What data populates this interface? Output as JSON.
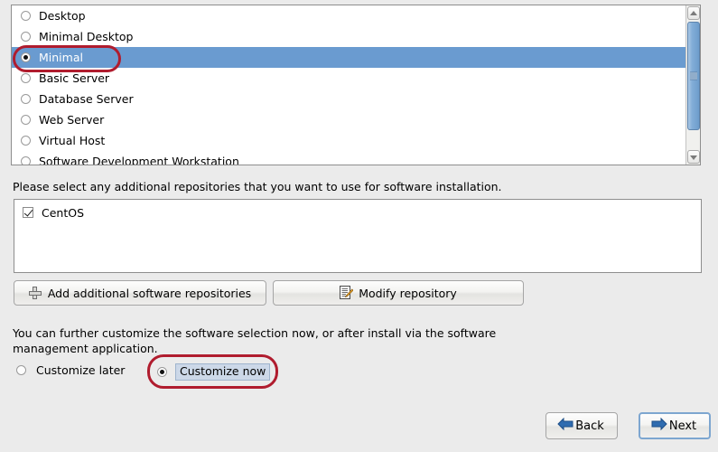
{
  "colors": {
    "background": "#ebebeb",
    "selection_blue": "#6a9bd0",
    "annotation_red": "#b01c2e",
    "focus_blue": "#7da6d0"
  },
  "group_list": {
    "items": [
      {
        "label": "Desktop",
        "selected": false
      },
      {
        "label": "Minimal Desktop",
        "selected": false
      },
      {
        "label": "Minimal",
        "selected": true
      },
      {
        "label": "Basic Server",
        "selected": false
      },
      {
        "label": "Database Server",
        "selected": false
      },
      {
        "label": "Web Server",
        "selected": false
      },
      {
        "label": "Virtual Host",
        "selected": false
      },
      {
        "label": "Software Development Workstation",
        "selected": false
      }
    ],
    "scrollbar": {
      "up_arrow_icon": "chevron-up-icon",
      "down_arrow_icon": "chevron-down-icon"
    }
  },
  "repositories": {
    "prompt": "Please select any additional repositories that you want to use for software installation.",
    "items": [
      {
        "label": "CentOS",
        "checked": true
      }
    ],
    "add_button": {
      "label": "Add additional software repositories",
      "icon": "plus-icon"
    },
    "modify_button": {
      "label": "Modify repository",
      "icon": "edit-document-icon"
    }
  },
  "customize": {
    "description": "You can further customize the software selection now, or after install via the software management application.",
    "options": [
      {
        "label": "Customize later",
        "selected": false
      },
      {
        "label": "Customize now",
        "selected": true
      }
    ]
  },
  "navigation": {
    "back": {
      "label": "Back",
      "icon": "arrow-left-icon"
    },
    "next": {
      "label": "Next",
      "icon": "arrow-right-icon"
    }
  }
}
